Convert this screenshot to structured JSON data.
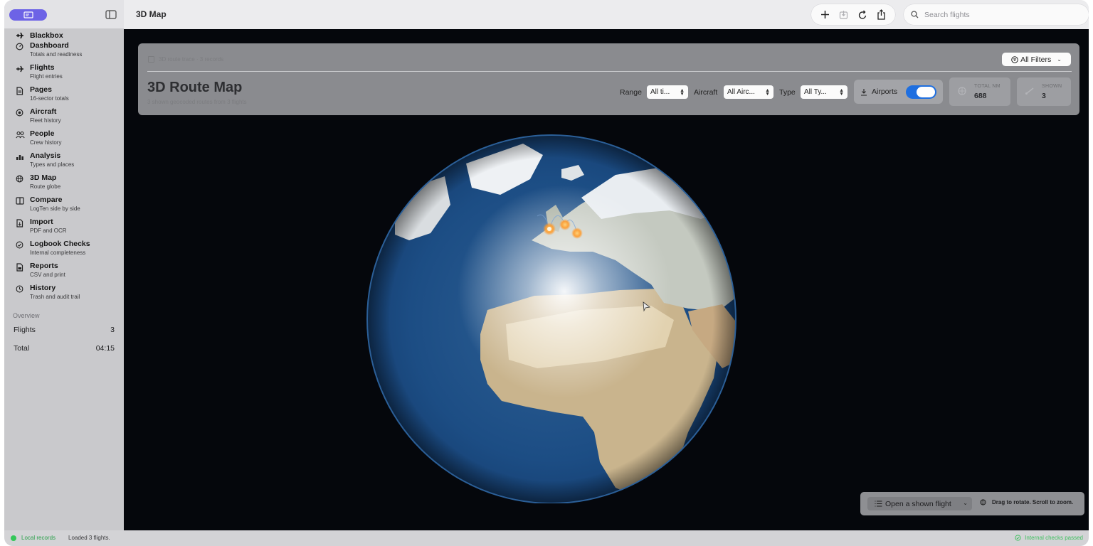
{
  "toolbar": {
    "title": "3D Map",
    "buttons": [
      "plus-icon",
      "download-icon",
      "refresh-icon",
      "share-icon"
    ],
    "search_placeholder": "Search flights"
  },
  "sidebar": {
    "app_name": "Blackbox",
    "items": [
      {
        "label": "Dashboard",
        "sub": "Totals and readiness",
        "icon": "gauge-icon"
      },
      {
        "label": "Flights",
        "sub": "Flight entries",
        "icon": "airplane-icon"
      },
      {
        "label": "Pages",
        "sub": "16-sector totals",
        "icon": "document-icon"
      },
      {
        "label": "Aircraft",
        "sub": "Fleet history",
        "icon": "aircraft-circle-icon"
      },
      {
        "label": "People",
        "sub": "Crew history",
        "icon": "people-icon"
      },
      {
        "label": "Analysis",
        "sub": "Types and places",
        "icon": "chart-icon"
      },
      {
        "label": "3D Map",
        "sub": "Route globe",
        "icon": "globe-icon"
      },
      {
        "label": "Compare",
        "sub": "LogTen side by side",
        "icon": "compare-icon"
      },
      {
        "label": "Import",
        "sub": "PDF and OCR",
        "icon": "import-icon"
      },
      {
        "label": "Logbook Checks",
        "sub": "Internal completeness",
        "icon": "checkmark-circle-icon"
      },
      {
        "label": "Reports",
        "sub": "CSV and print",
        "icon": "report-icon"
      },
      {
        "label": "History",
        "sub": "Trash and audit trail",
        "icon": "history-icon"
      }
    ],
    "overview_label": "Overview",
    "overview": [
      {
        "label": "Flights",
        "value": "3"
      },
      {
        "label": "Total",
        "value": "04:15"
      }
    ]
  },
  "panel": {
    "crumb": "3D route trace · 3 records",
    "title": "3D Route Map",
    "subtitle": "3 shown geocoded routes from 3 flights",
    "all_filters": "All Filters",
    "filters": [
      {
        "label": "Range",
        "value": "All ti..."
      },
      {
        "label": "Aircraft",
        "value": "All Airc..."
      },
      {
        "label": "Type",
        "value": "All Ty..."
      }
    ],
    "airports_label": "Airports",
    "airports_on": true,
    "stats": [
      {
        "label": "TOTAL NM",
        "value": "688"
      },
      {
        "label": "SHOWN",
        "value": "3"
      }
    ]
  },
  "map": {
    "open_flight": "Open a shown flight",
    "hint": "Drag to rotate. Scroll to zoom."
  },
  "status": {
    "local": "Local records",
    "loaded": "Loaded 3 flights.",
    "checks": "Internal checks passed"
  },
  "colors": {
    "accent": "#6d63e6",
    "toggle": "#1f6fe0",
    "status_ok": "#34c759",
    "map_bg": "#05070c"
  }
}
